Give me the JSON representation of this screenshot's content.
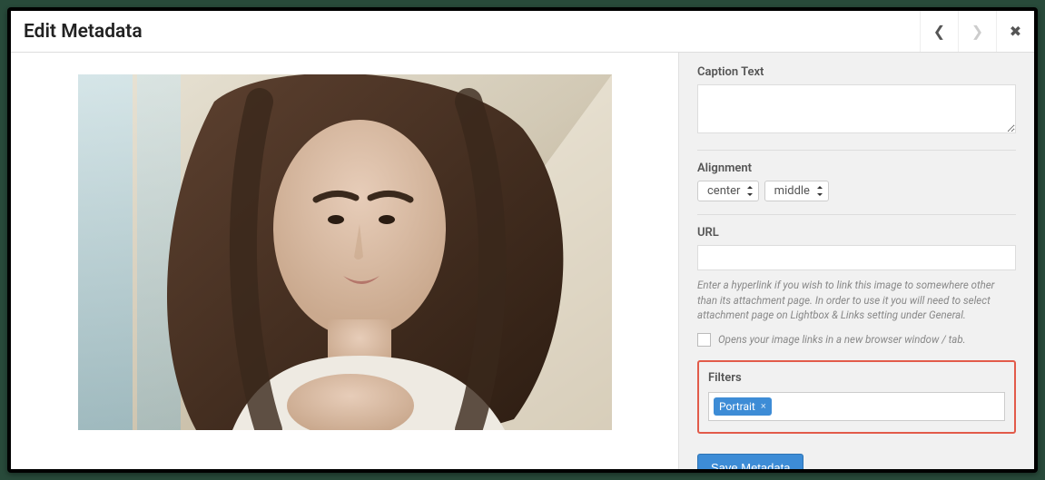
{
  "header": {
    "title": "Edit Metadata"
  },
  "caption": {
    "label": "Caption Text",
    "value": ""
  },
  "alignment": {
    "label": "Alignment",
    "horizontal": "center",
    "vertical": "middle"
  },
  "url": {
    "label": "URL",
    "value": "",
    "help": "Enter a hyperlink if you wish to link this image to somewhere other than its attachment page. In order to use it you will need to select attachment page on Lightbox & Links setting under General.",
    "checkbox_label": "Opens your image links in a new browser window / tab."
  },
  "filters": {
    "label": "Filters",
    "tags": [
      "Portrait"
    ]
  },
  "buttons": {
    "save": "Save Metadata"
  }
}
